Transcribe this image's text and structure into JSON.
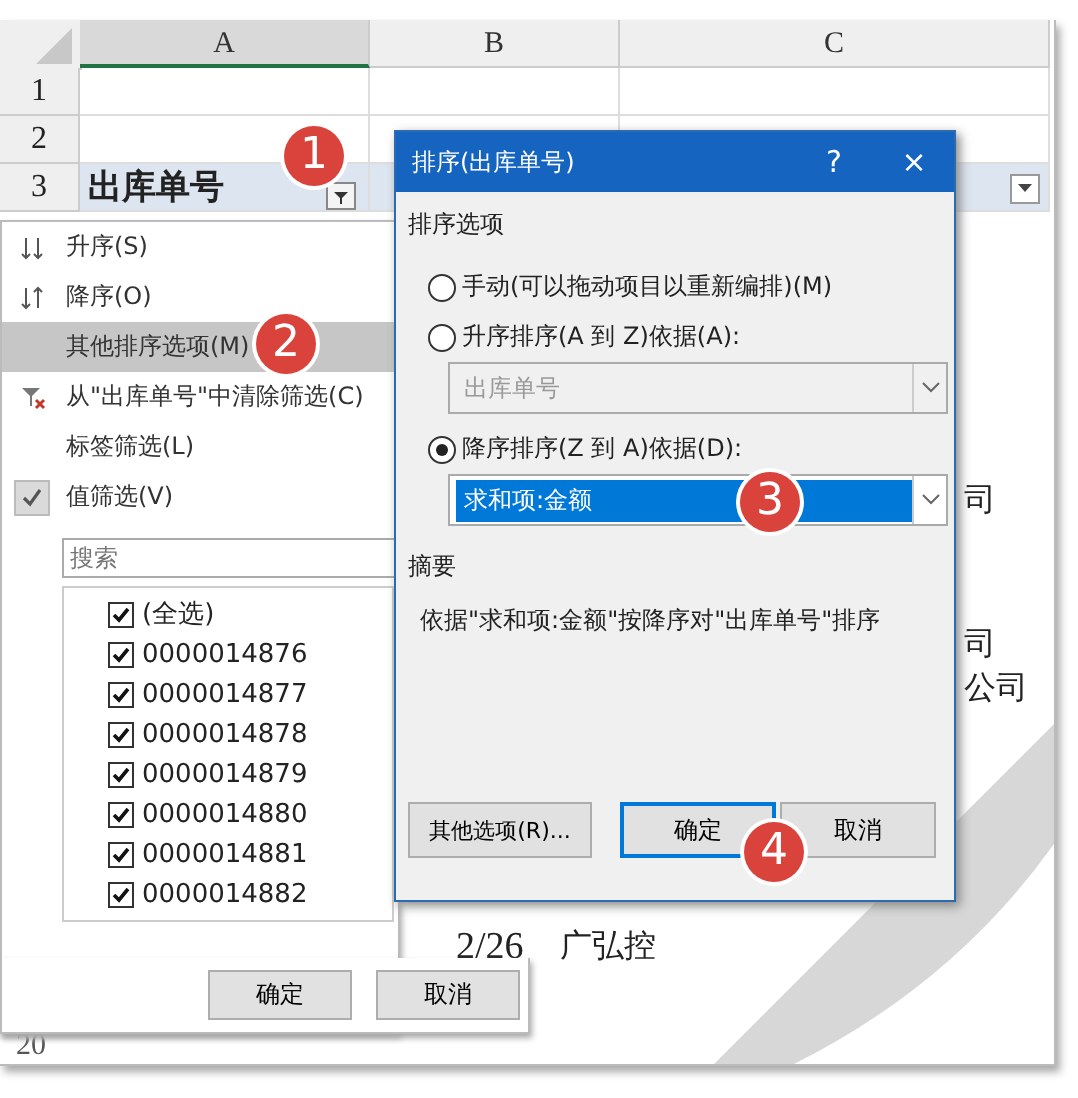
{
  "sheet": {
    "columns": [
      "A",
      "B",
      "C"
    ],
    "rows": [
      {
        "label": "1",
        "cells": [
          "",
          "",
          ""
        ]
      },
      {
        "label": "2",
        "cells": [
          "",
          "",
          ""
        ]
      },
      {
        "label": "3",
        "cells": [
          "出库单号",
          "",
          ""
        ]
      }
    ],
    "fragments": [
      "司",
      "司",
      "公司",
      "2/26",
      "广弘控"
    ],
    "bottom_row": "20"
  },
  "menu": {
    "items": [
      {
        "kind": "sort-asc",
        "label": "升序(S)",
        "selected": false,
        "checked": false
      },
      {
        "kind": "sort-desc",
        "label": "降序(O)",
        "selected": false,
        "checked": false
      },
      {
        "kind": "plain",
        "label": "其他排序选项(M)",
        "selected": true,
        "checked": false
      },
      {
        "kind": "clear-filter",
        "label": "从\"出库单号\"中清除筛选(C)",
        "selected": false,
        "checked": false
      },
      {
        "kind": "plain",
        "label": "标签筛选(L)",
        "selected": false,
        "checked": false
      },
      {
        "kind": "plain",
        "label": "值筛选(V)",
        "selected": false,
        "checked": true
      }
    ],
    "search": {
      "placeholder": "搜索"
    },
    "values": [
      {
        "label": "(全选)",
        "checked": true
      },
      {
        "label": "0000014876",
        "checked": true
      },
      {
        "label": "0000014877",
        "checked": true
      },
      {
        "label": "0000014878",
        "checked": true
      },
      {
        "label": "0000014879",
        "checked": true
      },
      {
        "label": "0000014880",
        "checked": true
      },
      {
        "label": "0000014881",
        "checked": true
      },
      {
        "label": "0000014882",
        "checked": true
      }
    ],
    "buttons": [
      "确定",
      "取消"
    ]
  },
  "dialog": {
    "title": "排序(出库单号)",
    "help": "?",
    "close": "×",
    "group": "排序选项",
    "options": [
      {
        "label": "手动(可以拖动项目以重新编排)(M)",
        "selected": false
      },
      {
        "label": "升序排序(A 到 Z)依据(A):",
        "selected": false,
        "combo": {
          "value": "出库单号",
          "disabled": true,
          "highlighted": false
        }
      },
      {
        "label": "降序排序(Z 到 A)依据(D):",
        "selected": true,
        "combo": {
          "value": "求和项:金额",
          "disabled": false,
          "highlighted": true
        }
      }
    ],
    "summary_title": "摘要",
    "summary": "依据\"求和项:金额\"按降序对\"出库单号\"排序",
    "buttons": [
      {
        "label": "其他选项(R)...",
        "focused": false
      },
      {
        "label": "确定",
        "focused": true
      },
      {
        "label": "取消",
        "focused": false
      }
    ]
  },
  "steps": [
    "1",
    "2",
    "3",
    "4"
  ]
}
